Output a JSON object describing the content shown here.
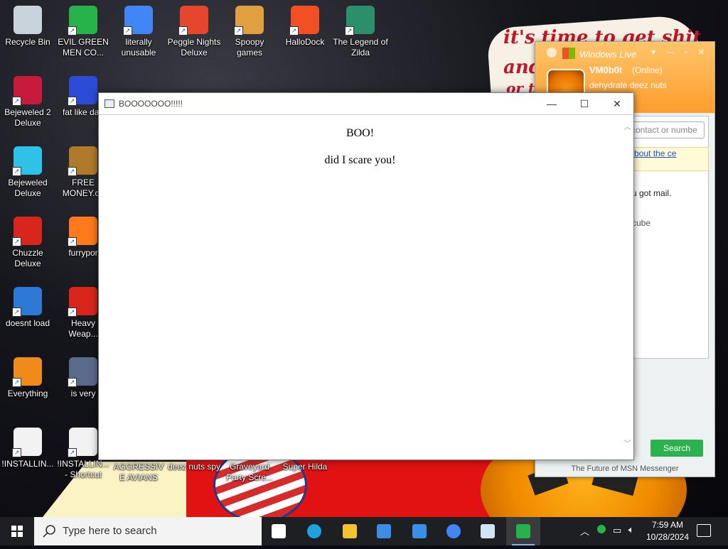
{
  "desktop": {
    "icons": [
      {
        "label": "Recycle Bin",
        "icon": "recycle-bin-icon",
        "color": "#c9d3dc"
      },
      {
        "label": "EVIL GREEN MEN CO...",
        "icon": "msn-people-icon",
        "color": "#27b34a"
      },
      {
        "label": "literally unusable",
        "icon": "chrome-icon",
        "color": "#4285f4"
      },
      {
        "label": "Peggle Nights Deluxe",
        "icon": "peggle-icon",
        "color": "#e6462c"
      },
      {
        "label": "Spoopy games",
        "icon": "folder-icon",
        "color": "#e0a040"
      },
      {
        "label": "HalloDock",
        "icon": "windows-shield-icon",
        "color": "#f25022"
      },
      {
        "label": "The Legend of Zilda",
        "icon": "zelda-icon",
        "color": "#2a8f6a"
      },
      {
        "label": "Bejeweled 2 Deluxe",
        "icon": "bejeweled2-icon",
        "color": "#c81a3a"
      },
      {
        "label": "fat like darl",
        "icon": "mpl-icon",
        "color": "#2c4bd6"
      },
      {
        "label": "Bejeweled Deluxe",
        "icon": "gem-icon",
        "color": "#2fc2e8"
      },
      {
        "label": "FREE MONEY.co",
        "icon": "money-bag-icon",
        "color": "#b07a2a"
      },
      {
        "label": "Chuzzle Deluxe",
        "icon": "chuzzle-icon",
        "color": "#d8261c"
      },
      {
        "label": "furrypor",
        "icon": "firefox-icon",
        "color": "#ff7a1a"
      },
      {
        "label": "doesnt load",
        "icon": "thunderbird-icon",
        "color": "#2e79d6"
      },
      {
        "label": "Heavy Weap...",
        "icon": "radiation-icon",
        "color": "#d8261c"
      },
      {
        "label": "Everything",
        "icon": "everything-search-icon",
        "color": "#f08a1a"
      },
      {
        "label": "is very",
        "icon": "mpl-shield-icon",
        "color": "#5a6a8a"
      },
      {
        "label": "!INSTALLIN...",
        "icon": "text-file-icon",
        "color": "#f2f2f2"
      },
      {
        "label": "!INSTALLIN... - Shortcut",
        "icon": "text-file-icon",
        "color": "#f2f2f2"
      },
      {
        "label": "AGGRESSIVE AVIANS",
        "icon": "",
        "color": ""
      },
      {
        "label": "deez nuts spy",
        "icon": "",
        "color": ""
      },
      {
        "label": "Graveyard Party Scre...",
        "icon": "",
        "color": ""
      },
      {
        "label": "Super Hilda",
        "icon": "",
        "color": ""
      }
    ],
    "wallpaper_text": [
      "it's time to get shit",
      "and",
      "or t"
    ]
  },
  "msn": {
    "app_title": "Windows Live",
    "username": "VM0b0t",
    "status": "(Online)",
    "personal_message": "dehydrate deez nuts",
    "search_placeholder": "contact or numbe",
    "news_link": "bout the ce",
    "line1": "u got mail.",
    "line2": "cube",
    "search_button": "Search",
    "footer": "The Future of MSN Messenger",
    "accent": "#ff9d2e"
  },
  "window": {
    "title": "BOOOOOOO!!!!!",
    "heading": "BOO!",
    "message": "did I scare you!",
    "minimize": "—",
    "maximize": "☐",
    "close": "✕"
  },
  "taskbar": {
    "search_placeholder": "Type here to search",
    "apps": [
      {
        "name": "task-view-icon",
        "color": "#ffffff"
      },
      {
        "name": "edge-icon",
        "color": "#1fa0e0"
      },
      {
        "name": "file-explorer-icon",
        "color": "#f2c230"
      },
      {
        "name": "store-icon",
        "color": "#3a8ee6"
      },
      {
        "name": "mail-icon",
        "color": "#3a8ee6"
      },
      {
        "name": "chrome-icon",
        "color": "#4285f4"
      },
      {
        "name": "app-window-icon",
        "color": "#d0e4f5"
      },
      {
        "name": "msn-messenger-icon",
        "color": "#27b34a"
      }
    ],
    "time": "7:59 AM",
    "date": "10/28/2024"
  }
}
